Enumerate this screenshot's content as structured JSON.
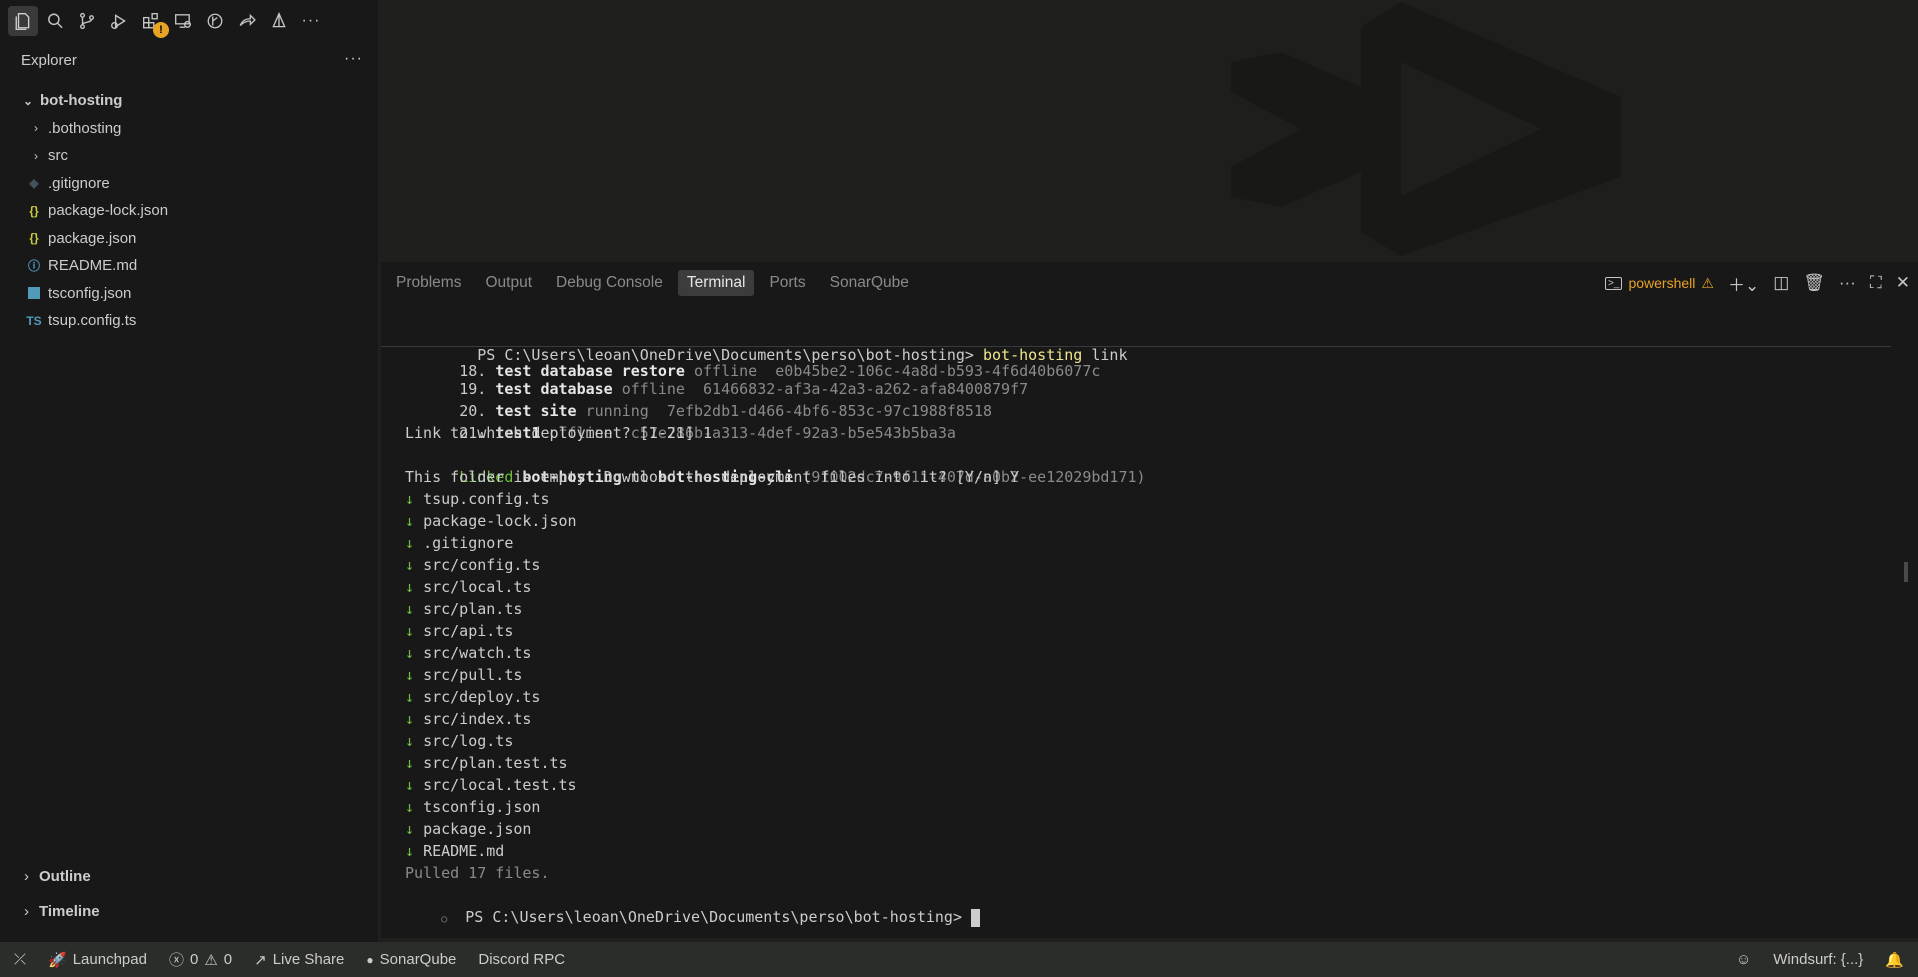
{
  "sidebar": {
    "title": "Explorer",
    "more": "···",
    "root": "bot-hosting",
    "items": [
      {
        "name": ".bothosting",
        "kind": "folder",
        "icon": ""
      },
      {
        "name": "src",
        "kind": "folder",
        "icon": ""
      },
      {
        "name": ".gitignore",
        "kind": "file",
        "icon": "git-icon"
      },
      {
        "name": "package-lock.json",
        "kind": "file",
        "icon": "{}"
      },
      {
        "name": "package.json",
        "kind": "file",
        "icon": "{}"
      },
      {
        "name": "README.md",
        "kind": "file",
        "icon": "ⓘ"
      },
      {
        "name": "tsconfig.json",
        "kind": "file",
        "icon": "ts-config-icon"
      },
      {
        "name": "tsup.config.ts",
        "kind": "file",
        "icon": "TS"
      }
    ],
    "outline": "Outline",
    "timeline": "Timeline"
  },
  "panel": {
    "tabs": [
      "Problems",
      "Output",
      "Debug Console",
      "Terminal",
      "Ports",
      "SonarQube"
    ],
    "active_tab": "Terminal",
    "shell": "powershell"
  },
  "terminal": {
    "sticky_prompt": "PS C:\\Users\\leoan\\OneDrive\\Documents\\perso\\bot-hosting>",
    "sticky_cmd": "bot-hosting",
    "sticky_arg": "link",
    "deployments": [
      {
        "idx": "18.",
        "name": "test database restore",
        "status": "offline",
        "id": "e0b45be2-106c-4a8d-b593-4f6d40b6077c"
      },
      {
        "idx": "19.",
        "name": "test database",
        "status": "offline",
        "id": "61466832-af3a-42a3-a262-afa8400879f7"
      },
      {
        "idx": "20.",
        "name": "test site",
        "status": "running",
        "id": "7efb2db1-d466-4bf6-853c-97c1988f8518"
      },
      {
        "idx": "21.",
        "name": "test1",
        "status": "offline",
        "id": "c57e786b-a313-4def-92a3-b5e543b5ba3a"
      }
    ],
    "link_question": "Link to which deployment? [1-21] 1",
    "linked_word": "Linked",
    "linked_from": "bot-hosting",
    "linked_to_word": "to",
    "linked_to": "bot-hosting-cli",
    "linked_id": "(91002dc7-9f11-407d-a0b2-ee12029bd171)",
    "download_question": "This folder is empty. Download the deployment files into it? [Y/n] Y",
    "arrow": "↓",
    "files": [
      "tsup.config.ts",
      "package-lock.json",
      ".gitignore",
      "src/config.ts",
      "src/local.ts",
      "src/plan.ts",
      "src/api.ts",
      "src/watch.ts",
      "src/pull.ts",
      "src/deploy.ts",
      "src/index.ts",
      "src/log.ts",
      "src/plan.test.ts",
      "src/local.test.ts",
      "tsconfig.json",
      "package.json",
      "README.md"
    ],
    "summary": "Pulled 17 files.",
    "final_prompt": "PS C:\\Users\\leoan\\OneDrive\\Documents\\perso\\bot-hosting>"
  },
  "statusbar": {
    "launchpad": "Launchpad",
    "errors": "0",
    "warnings": "0",
    "live_share": "Live Share",
    "sonarqube": "SonarQube",
    "discord": "Discord RPC",
    "windsurf": "Windsurf: {...}"
  },
  "colors": {
    "accent_warn": "#e8a224",
    "green": "#6fbf3f",
    "yellow": "#f0e68c"
  }
}
